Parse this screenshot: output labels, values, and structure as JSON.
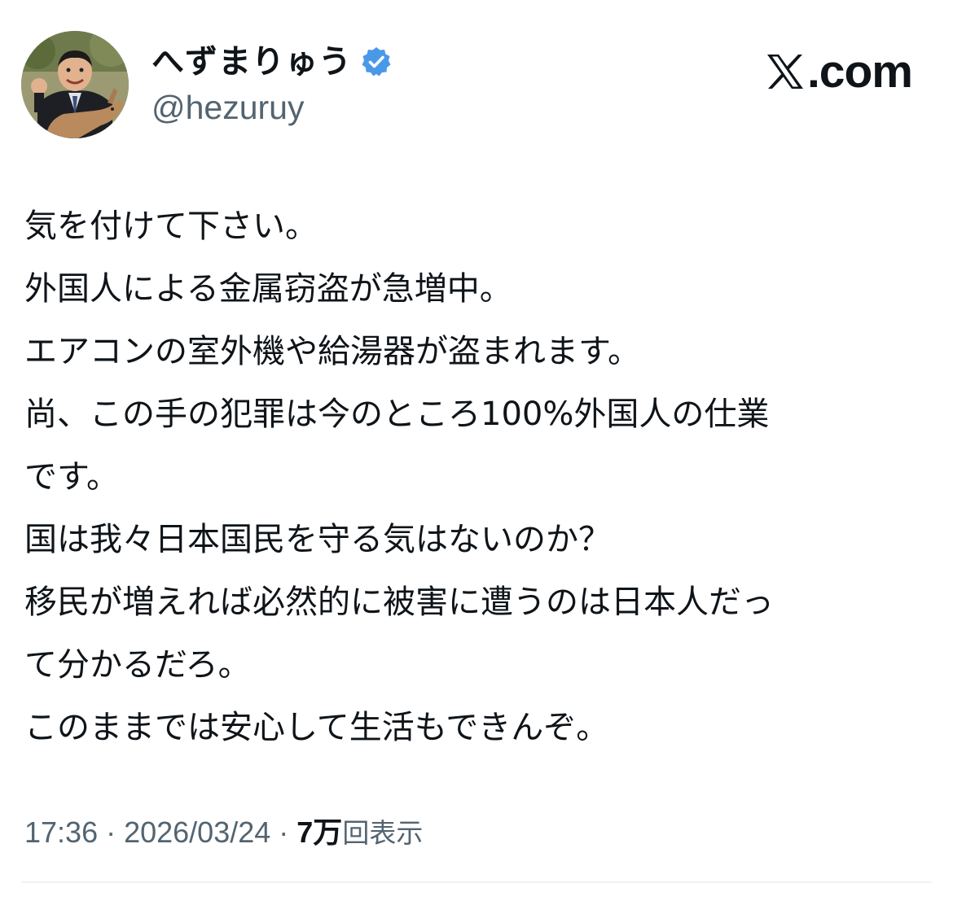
{
  "author": {
    "display_name": "へずまりゅう",
    "handle": "@hezuruy",
    "verified": true,
    "verified_badge_color": "#4a99e9"
  },
  "brand": {
    "label": ".com"
  },
  "post": {
    "lines": [
      "気を付けて下さい。",
      "外国人による金属窃盗が急増中。",
      "エアコンの室外機や給湯器が盗まれます。",
      "尚、この手の犯罪は今のところ100%外国人の仕業",
      "です。",
      "国は我々日本国民を守る気はないのか？",
      "移民が増えれば必然的に被害に遭うのは日本人だっ",
      "て分かるだろ。",
      "このままでは安心して生活もできんぞ。"
    ]
  },
  "meta": {
    "time": "17:36",
    "separator": " · ",
    "date": "2026/03/24",
    "views_count": "7万",
    "views_label": "回表示"
  },
  "colors": {
    "text_primary": "#0f1419",
    "text_secondary": "#536471",
    "divider": "#eff3f4"
  }
}
